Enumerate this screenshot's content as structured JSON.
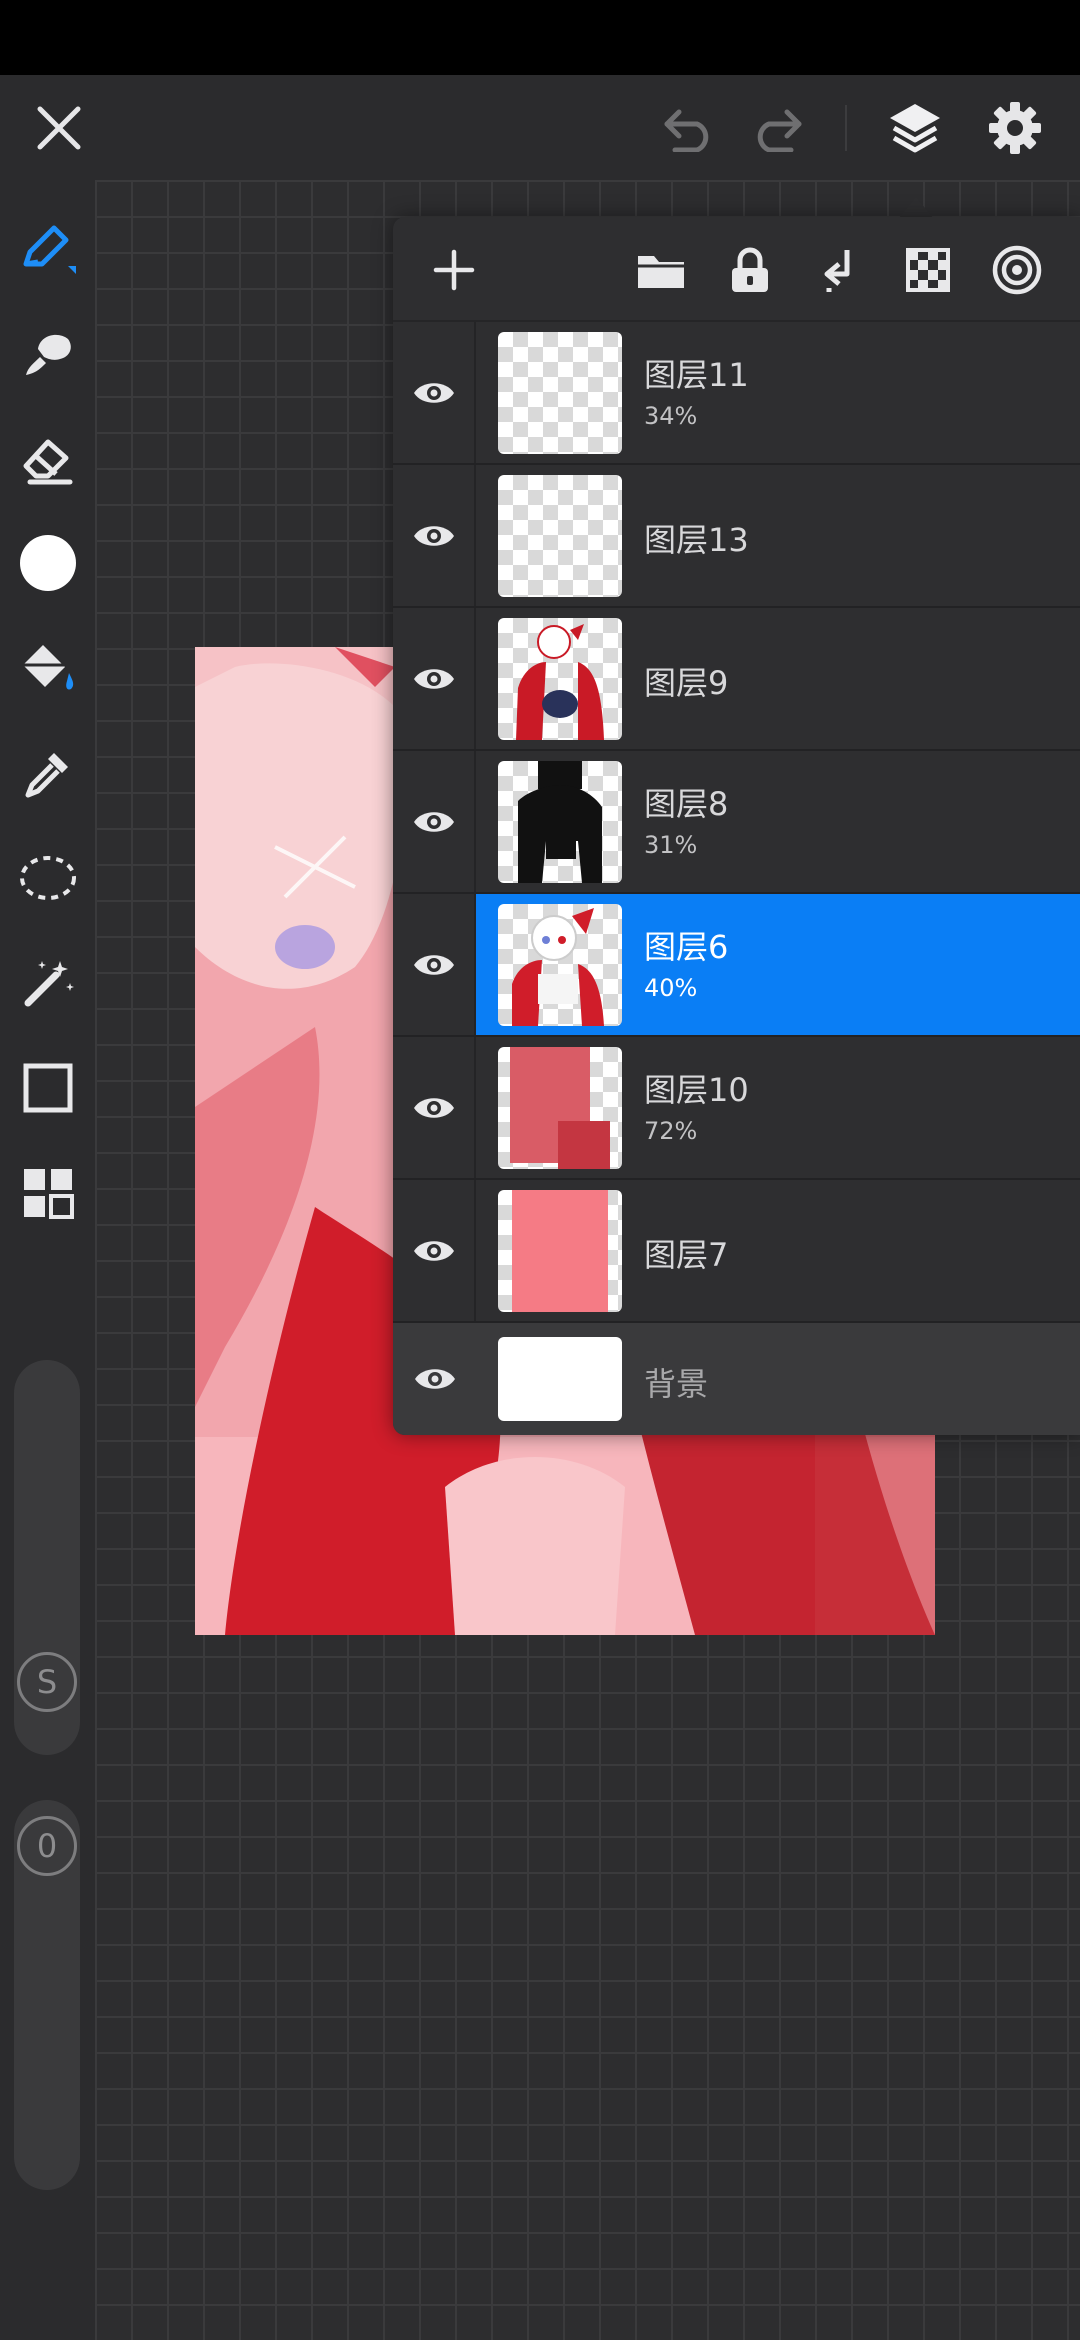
{
  "layers": [
    {
      "name": "图层11",
      "opacity": "34%",
      "selected": false
    },
    {
      "name": "图层13",
      "opacity": "",
      "selected": false
    },
    {
      "name": "图层9",
      "opacity": "",
      "selected": false
    },
    {
      "name": "图层8",
      "opacity": "31%",
      "selected": false
    },
    {
      "name": "图层6",
      "opacity": "40%",
      "selected": true
    },
    {
      "name": "图层10",
      "opacity": "72%",
      "selected": false
    },
    {
      "name": "图层7",
      "opacity": "",
      "selected": false
    }
  ],
  "background_layer": {
    "name": "背景"
  },
  "sliders": {
    "size_badge": "S",
    "opacity_badge": "0"
  },
  "colors": {
    "accent": "#0a7ef5",
    "current_color": "#ffffff",
    "panel": "#2e2e30"
  },
  "icons": {
    "top": [
      "close-icon",
      "undo-icon",
      "redo-icon",
      "layers-icon",
      "settings-icon"
    ],
    "panel": [
      "add-layer-icon",
      "folder-icon",
      "lock-icon",
      "merge-down-icon",
      "transparency-icon",
      "blend-icon"
    ],
    "tools": [
      "pen-icon",
      "smudge-icon",
      "eraser-icon",
      "color-icon",
      "fill-icon",
      "eyedropper-icon",
      "lasso-icon",
      "magic-wand-icon",
      "shape-icon",
      "grid-icon"
    ]
  }
}
